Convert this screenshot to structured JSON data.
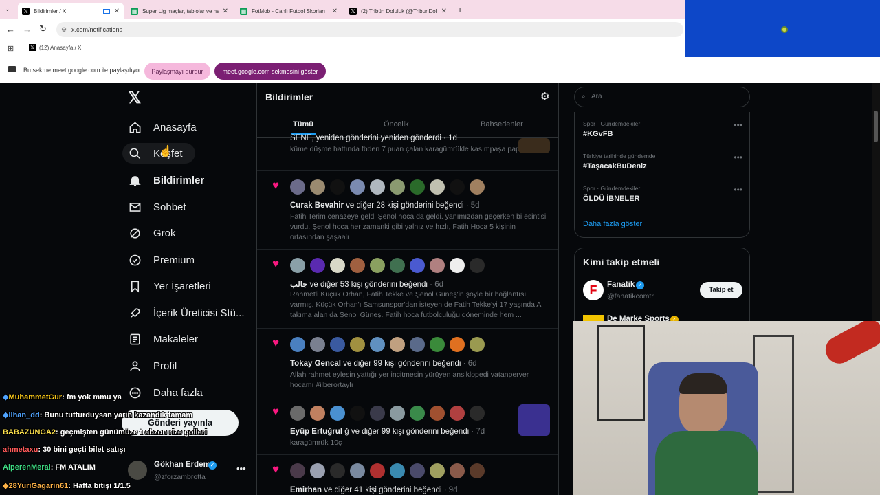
{
  "browser": {
    "tabs": [
      {
        "title": "Bildirimler / X",
        "active": true
      },
      {
        "title": "Super Lig maçlar, tablolar ve ha",
        "active": false
      },
      {
        "title": "FotMob - Canlı Futbol Skorları",
        "active": false
      },
      {
        "title": "(2) Tribün Doluluk (@TribunDol",
        "active": false
      }
    ],
    "url": "x.com/notifications",
    "bookmark": "(12) Anasayfa / X"
  },
  "share": {
    "message": "Bu sekme meet.google.com ile paylaşılıyor",
    "stop_label": "Paylaşmayı durdur",
    "show_label": "meet.google.com sekmesini göster"
  },
  "nav": {
    "items": [
      {
        "label": "Anasayfa",
        "icon": "home-icon"
      },
      {
        "label": "Keşfet",
        "icon": "search-icon"
      },
      {
        "label": "Bildirimler",
        "icon": "bell-icon"
      },
      {
        "label": "Sohbet",
        "icon": "mail-icon"
      },
      {
        "label": "Grok",
        "icon": "grok-icon"
      },
      {
        "label": "Premium",
        "icon": "premium-icon"
      },
      {
        "label": "Yer İşaretleri",
        "icon": "bookmark-icon"
      },
      {
        "label": "İçerik Üreticisi Stü...",
        "icon": "rocket-icon"
      },
      {
        "label": "Makaleler",
        "icon": "article-icon"
      },
      {
        "label": "Profil",
        "icon": "profile-icon"
      },
      {
        "label": "Daha fazla",
        "icon": "more-icon"
      }
    ],
    "post_label": "Gönderi yayınla",
    "account": {
      "name": "Gökhan Erdem",
      "handle": "@zforzambrotta"
    }
  },
  "feed": {
    "title": "Bildirimler",
    "tabs": [
      "Tümü",
      "Öncelik",
      "Bahsedenler"
    ],
    "top_partial": {
      "line": "SENE, yeniden gönderini yeniden gönderdi · 1d",
      "text": "küme düşme hattında fbden 7 puan çalan karagümrükle kasımpaşa papi"
    },
    "notifications": [
      {
        "name": "Curak Bevahir",
        "rest": " ve diğer 28 kişi gönderini beğendi",
        "ago": " · 5d",
        "text": "Fatih Terim cenazeye geldi Şenol hoca da geldi. yanımızdan geçerken bi esintisi vurdu. Şenol hoca her zamanki gibi yalnız ve hızlı, Fatih Hoca 5 kişinin ortasından şaşaalı"
      },
      {
        "name": "جالب",
        "rest": " ve diğer 53 kişi gönderini beğendi",
        "ago": " · 6d",
        "text": "Rahmetli Küçük Orhan, Fatih Tekke ve Şenol Güneş'in şöyle bir bağlantısı varmış. Küçük Orhan'ı Samsunspor'dan isteyen de Fatih Tekke'yi 17 yaşında A takıma alan da Şenol Güneş. Fatih hoca futbolculuğu döneminde hem ..."
      },
      {
        "name": "Tokay Gencal",
        "rest": " ve diğer 99 kişi gönderini beğendi",
        "ago": " · 6d",
        "text": "Allah rahmet eylesin yattığı yer incitmesin yürüyen ansiklopedi vatanperver hocamı #ilberortaylı"
      },
      {
        "name": "Eyüp Ertuğrul ",
        "rest": "ğ ve diğer 99 kişi gönderini beğendi",
        "ago": " · 7d",
        "text": "karagümrük 10ç"
      },
      {
        "name": "Emirhan",
        "rest": " ve diğer 41 kişi gönderini beğendi",
        "ago": " · 9d",
        "text": ""
      }
    ]
  },
  "right": {
    "search_placeholder": "Ara",
    "trends": [
      {
        "cat": "Spor · Gündemdekiler",
        "name": "#KGvFB"
      },
      {
        "cat": "Türkiye tarihinde gündemde",
        "name": "#TaşacakBuDeniz"
      },
      {
        "cat": "Spor · Gündemdekiler",
        "name": "ÖLDÜ İBNELER"
      }
    ],
    "show_more": "Daha fazla göster",
    "who_to_follow": "Kimi takip etmeli",
    "follow": [
      {
        "name": "Fanatik",
        "handle": "@fanatikcomtr",
        "btn": "Takip et"
      },
      {
        "name": "De Marke Sports",
        "handle": ""
      }
    ]
  },
  "chat": [
    {
      "user": "MuhammetGur",
      "msg": ": fm yok mmu ya",
      "color": "#f5c518"
    },
    {
      "user": "Ilhan_dd",
      "msg": ": Bunu tutturduysan yarın kazandık tamam",
      "color": "#4fa3ff"
    },
    {
      "user": "BABAZUNGA2",
      "msg": ": geçmişten günümüze trabzon rize golleri",
      "color": "#ffe34d"
    },
    {
      "user": "ahmetaxu",
      "msg": ": 30 bini geçti bilet satışı",
      "color": "#ff5a5a"
    },
    {
      "user": "AlperenMeral",
      "msg": ": FM ATALIM",
      "color": "#3ddc84"
    },
    {
      "user": "28YuriGagarin61",
      "msg": ": Hafta bitişi 1/1.5",
      "color": "#ffb347"
    }
  ],
  "colors": {
    "accent": "#1d9bf0",
    "like": "#f91880",
    "share_pink": "#f5b8dc",
    "share_purple": "#7b1f73"
  }
}
